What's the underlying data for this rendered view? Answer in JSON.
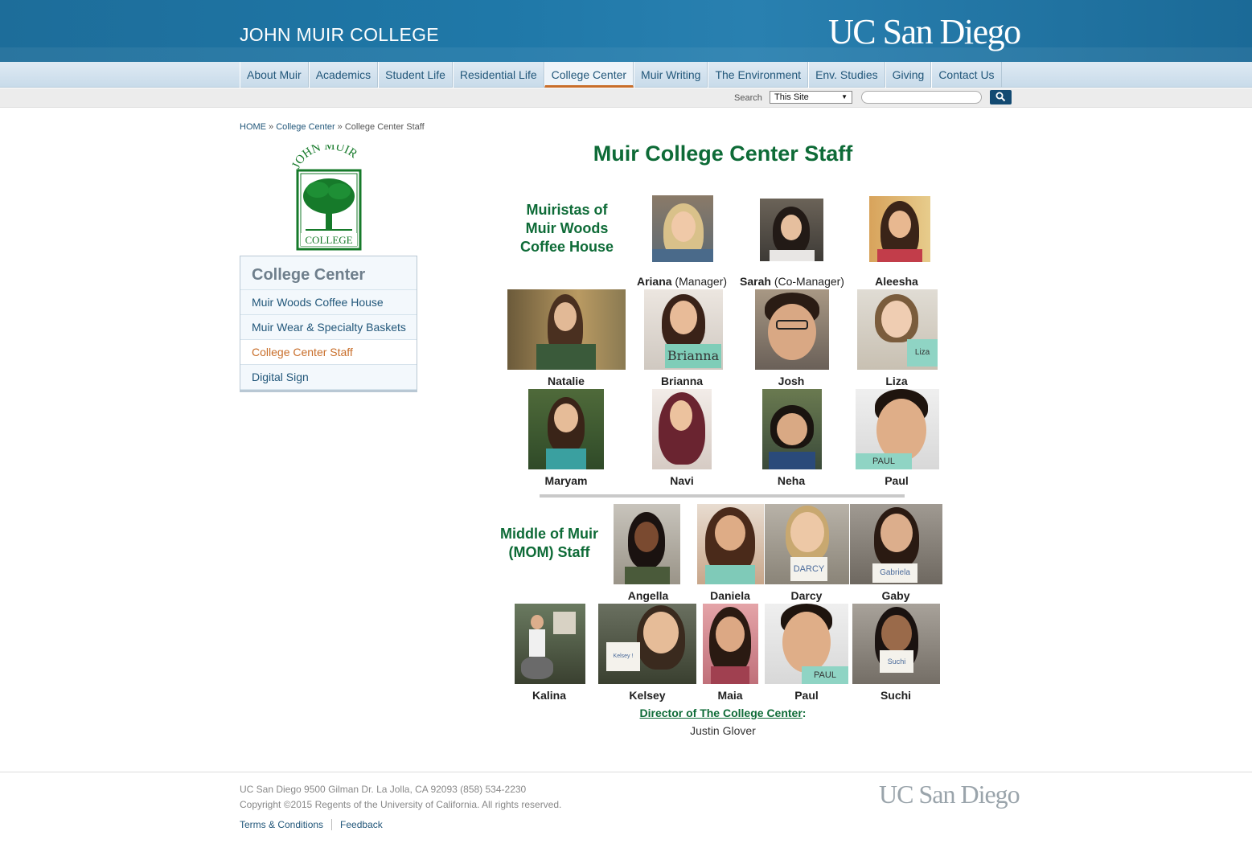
{
  "header": {
    "college_name": "JOHN MUIR COLLEGE",
    "ucsd_logo": "UC San Diego"
  },
  "nav": {
    "items": [
      "About Muir",
      "Academics",
      "Student Life",
      "Residential Life",
      "College Center",
      "Muir Writing",
      "The Environment",
      "Env. Studies",
      "Giving",
      "Contact Us"
    ],
    "active": "College Center"
  },
  "search": {
    "label": "Search",
    "scope": "This Site",
    "placeholder": "",
    "button_icon": "search-icon"
  },
  "breadcrumb": {
    "home": "HOME",
    "sep": " » ",
    "parent": "College Center",
    "current": "College Center Staff"
  },
  "logo_alt": "John Muir College",
  "sidebar": {
    "title": "College Center",
    "items": [
      "Muir Woods Coffee House",
      "Muir Wear & Specialty Baskets",
      "College Center Staff",
      "Digital Sign"
    ],
    "active_index": 2
  },
  "main": {
    "title": "Muir College Center Staff",
    "section1": {
      "line1": "Muiristas of",
      "line2": "Muir Woods",
      "line3": "Coffee House"
    },
    "section2": {
      "line1": "Middle of Muir",
      "line2": "(MOM) Staff"
    },
    "staff": {
      "ariana": {
        "name": "Ariana",
        "role": " (Manager)"
      },
      "sarah": {
        "name": "Sarah",
        "role": " (Co-Manager)"
      },
      "aleesha": "Aleesha",
      "natalie": "Natalie",
      "brianna": "Brianna",
      "josh": "Josh",
      "liza": "Liza",
      "maryam": "Maryam",
      "navi": "Navi",
      "neha": "Neha",
      "paul1": "Paul",
      "angella": "Angella",
      "daniela": "Daniela",
      "darcy": "Darcy",
      "gaby": "Gaby",
      "kalina": "Kalina",
      "kelsey": "Kelsey",
      "maia": "Maia",
      "paul2": "Paul",
      "suchi": "Suchi"
    },
    "director_label": "Director of The College Center",
    "director_colon": ":",
    "director_name": "Justin Glover"
  },
  "footer": {
    "address": "UC San Diego 9500 Gilman Dr. La Jolla, CA 92093 (858) 534-2230",
    "copyright": "Copyright ©2015 Regents of the University of California. All rights reserved.",
    "links": [
      "Terms & Conditions",
      "Feedback"
    ],
    "logo": "UC San Diego"
  }
}
